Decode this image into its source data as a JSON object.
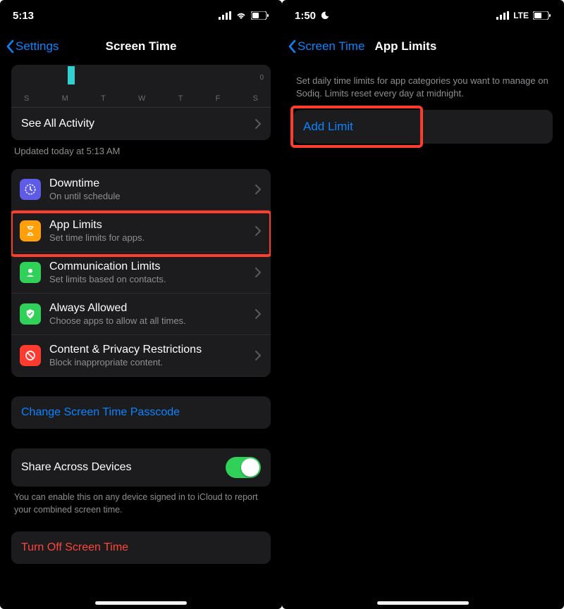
{
  "left": {
    "status_time": "5:13",
    "nav_back": "Settings",
    "nav_title": "Screen Time",
    "chart": {
      "days": [
        "S",
        "M",
        "T",
        "W",
        "T",
        "F",
        "S"
      ],
      "zero": "0"
    },
    "see_all": "See All Activity",
    "updated": "Updated today at 5:13 AM",
    "items": [
      {
        "title": "Downtime",
        "sub": "On until schedule"
      },
      {
        "title": "App Limits",
        "sub": "Set time limits for apps."
      },
      {
        "title": "Communication Limits",
        "sub": "Set limits based on contacts."
      },
      {
        "title": "Always Allowed",
        "sub": "Choose apps to allow at all times."
      },
      {
        "title": "Content & Privacy Restrictions",
        "sub": "Block inappropriate content."
      }
    ],
    "change_passcode": "Change Screen Time Passcode",
    "share_label": "Share Across Devices",
    "share_footnote": "You can enable this on any device signed in to iCloud to report your combined screen time.",
    "turn_off": "Turn Off Screen Time"
  },
  "right": {
    "status_time": "1:50",
    "net_label": "LTE",
    "nav_back": "Screen Time",
    "nav_title": "App Limits",
    "description": "Set daily time limits for app categories you want to manage on Sodiq. Limits reset every day at midnight.",
    "add_limit": "Add Limit"
  }
}
